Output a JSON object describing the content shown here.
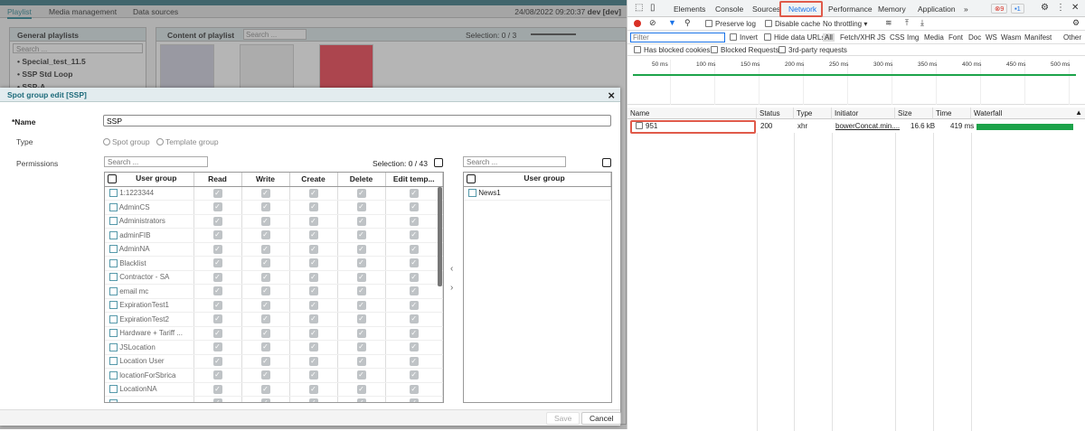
{
  "app": {
    "tabs": [
      "Playlist",
      "Media management",
      "Data sources"
    ],
    "datetime": "24/08/2022 09:20:37",
    "env": "dev [dev]",
    "left_panel": {
      "title": "General playlists",
      "search_placeholder": "Search ...",
      "items": [
        "Special_test_11.5",
        "SSP Std Loop",
        "SSP-A"
      ]
    },
    "content_panel": {
      "title": "Content of playlist",
      "search_placeholder": "Search ...",
      "selection": "Selection: 0 / 3"
    }
  },
  "dialog": {
    "title": "Spot group edit [SSP]",
    "close": "×",
    "name_label": "*Name",
    "name_value": "SSP",
    "type_label": "Type",
    "type_options": [
      "Spot group",
      "Template group"
    ],
    "permissions_label": "Permissions",
    "left_search_placeholder": "Search ...",
    "left_selection": "Selection: 0 / 43",
    "right_search_placeholder": "Search ...",
    "columns": [
      "User group",
      "Read",
      "Write",
      "Create",
      "Delete",
      "Edit temp..."
    ],
    "user_groups": [
      "1:1223344",
      "AdminCS",
      "Administrators",
      "adminFIB",
      "AdminNA",
      "Blacklist",
      "Contractor - SA",
      "email mc",
      "ExpirationTest1",
      "ExpirationTest2",
      "Hardware + Tariff ...",
      "JSLocation",
      "Location User",
      "locationForSbrica",
      "LocationNA",
      "..."
    ],
    "right_columns": [
      "User group"
    ],
    "right_rows": [
      "News1"
    ],
    "move_left": "‹",
    "move_right": "›",
    "save": "Save",
    "cancel": "Cancel"
  },
  "devtools": {
    "tabs": [
      "Elements",
      "Console",
      "Sources",
      "Network",
      "Performance",
      "Memory",
      "Application",
      "»"
    ],
    "active_tab": "Network",
    "error_count": "9",
    "message_count": "1",
    "toolbar": {
      "preserve_log": "Preserve log",
      "disable_cache": "Disable cache",
      "throttling": "No throttling"
    },
    "filter": {
      "placeholder": "Filter",
      "invert": "Invert",
      "hide_data_urls": "Hide data URLs",
      "types": [
        "All",
        "Fetch/XHR",
        "JS",
        "CSS",
        "Img",
        "Media",
        "Font",
        "Doc",
        "WS",
        "Wasm",
        "Manifest",
        "Other"
      ],
      "has_blocked_cookies": "Has blocked cookies",
      "blocked_requests": "Blocked Requests",
      "third_party": "3rd-party requests"
    },
    "timeline_ticks": [
      "50 ms",
      "100 ms",
      "150 ms",
      "200 ms",
      "250 ms",
      "300 ms",
      "350 ms",
      "400 ms",
      "450 ms",
      "500 ms"
    ],
    "columns": [
      "Name",
      "Status",
      "Type",
      "Initiator",
      "Size",
      "Time",
      "Waterfall"
    ],
    "requests": [
      {
        "name": "951",
        "status": "200",
        "type": "xhr",
        "initiator": "bowerConcat.min....",
        "size": "16.6 kB",
        "time": "419 ms"
      }
    ],
    "colors": {
      "accent": "#1a73e8",
      "highlight": "#e05a4a",
      "waterfall": "#1ca34a"
    }
  }
}
